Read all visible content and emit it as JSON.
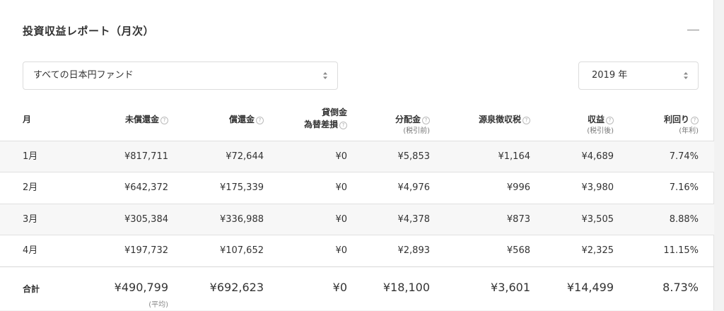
{
  "title": "投資収益レポート（月次）",
  "fund_select": {
    "value": "すべての日本円ファンド"
  },
  "year_select": {
    "value": "2019 年"
  },
  "headers": {
    "month": "月",
    "unredeemed": "未償還金",
    "redeemed": "償還金",
    "loss_line1": "貸倒金",
    "loss_line2": "為替差損",
    "dividend": "分配金",
    "dividend_sub": "(税引前)",
    "tax": "源泉徴収税",
    "profit": "収益",
    "profit_sub": "(税引後)",
    "yield": "利回り",
    "yield_sub": "(年利)",
    "help_glyph": "?"
  },
  "rows": [
    {
      "month": "1月",
      "unredeemed": "¥817,711",
      "redeemed": "¥72,644",
      "loss": "¥0",
      "dividend": "¥5,853",
      "tax": "¥1,164",
      "profit": "¥4,689",
      "yield": "7.74%"
    },
    {
      "month": "2月",
      "unredeemed": "¥642,372",
      "redeemed": "¥175,339",
      "loss": "¥0",
      "dividend": "¥4,976",
      "tax": "¥996",
      "profit": "¥3,980",
      "yield": "7.16%"
    },
    {
      "month": "3月",
      "unredeemed": "¥305,384",
      "redeemed": "¥336,988",
      "loss": "¥0",
      "dividend": "¥4,378",
      "tax": "¥873",
      "profit": "¥3,505",
      "yield": "8.88%"
    },
    {
      "month": "4月",
      "unredeemed": "¥197,732",
      "redeemed": "¥107,652",
      "loss": "¥0",
      "dividend": "¥2,893",
      "tax": "¥568",
      "profit": "¥2,325",
      "yield": "11.15%"
    }
  ],
  "total": {
    "label": "合計",
    "unredeemed": "¥490,799",
    "unredeemed_note": "(平均)",
    "redeemed": "¥692,623",
    "loss": "¥0",
    "dividend": "¥18,100",
    "tax": "¥3,601",
    "profit": "¥14,499",
    "yield": "8.73%"
  }
}
